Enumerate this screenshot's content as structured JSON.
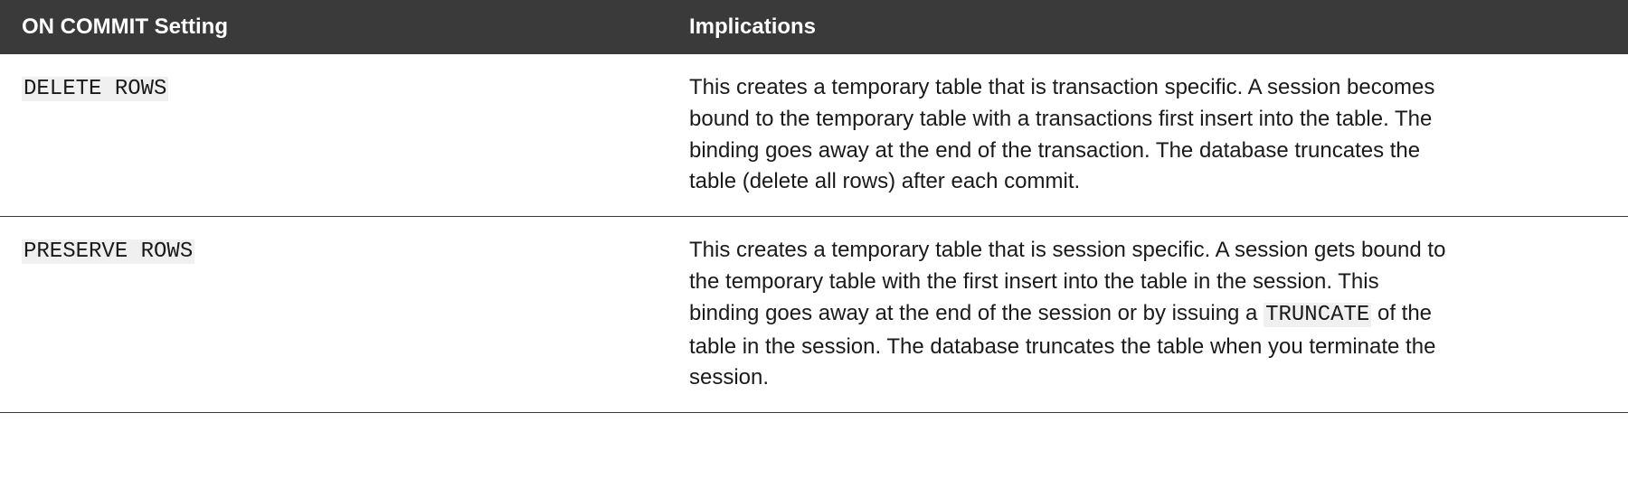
{
  "table": {
    "headers": [
      "ON COMMIT Setting",
      "Implications"
    ],
    "rows": [
      {
        "setting": "DELETE ROWS",
        "desc_before": "This creates a temporary table that is transaction specific. A session becomes bound to the temporary table with a transactions first insert into the table. The binding goes away at the end of the transaction. The database truncates the table (delete all rows) after each commit.",
        "desc_code": "",
        "desc_after": ""
      },
      {
        "setting": "PRESERVE ROWS",
        "desc_before": "This creates a temporary table that is session specific. A session gets bound to the temporary table with the first insert into the table in the session. This binding goes away at the end of the session or by issuing a ",
        "desc_code": "TRUNCATE",
        "desc_after": " of the table in the session. The database truncates the table when you terminate the session."
      }
    ]
  }
}
